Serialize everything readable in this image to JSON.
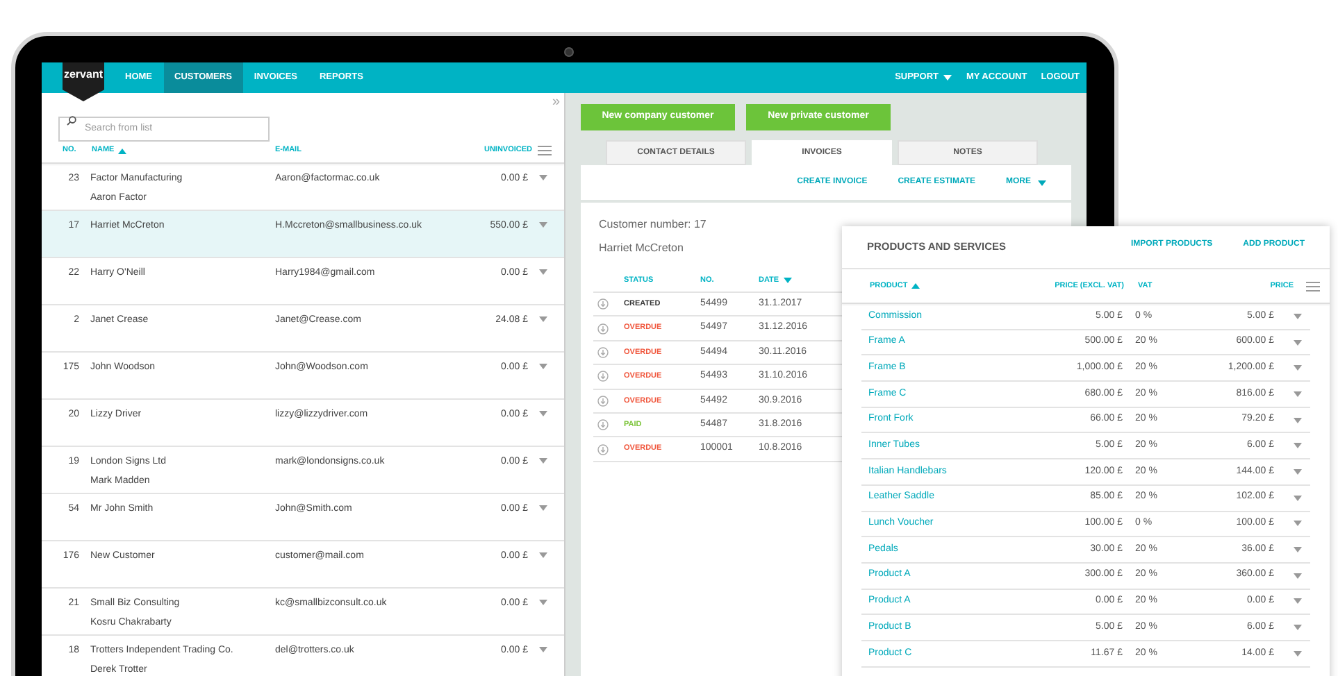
{
  "nav": {
    "logo": "zervant",
    "items": [
      {
        "label": "HOME",
        "selected": false
      },
      {
        "label": "CUSTOMERS",
        "selected": true
      },
      {
        "label": "INVOICES",
        "selected": false
      },
      {
        "label": "REPORTS",
        "selected": false
      }
    ],
    "right_items": [
      {
        "label": "SUPPORT",
        "has_menu": true
      },
      {
        "label": "MY ACCOUNT",
        "has_menu": false
      },
      {
        "label": "LOGOUT",
        "has_menu": false
      }
    ]
  },
  "customer_list": {
    "search": {
      "placeholder": "Search from list"
    },
    "collapse": "»",
    "columns": [
      {
        "label": "NO.",
        "sorted": false
      },
      {
        "label": "NAME",
        "sorted": true,
        "descending": false
      },
      {
        "label": "E-MAIL",
        "sorted": false
      },
      {
        "label": "UNINVOICED",
        "sorted": false
      }
    ],
    "rows": [
      {
        "no": "23",
        "name": "Factor Manufacturing",
        "contact": "Aaron Factor",
        "email": "Aaron@factormac.co.uk",
        "uninvoiced": "0.00 £",
        "selected": false
      },
      {
        "no": "17",
        "name": "Harriet McCreton",
        "email": "H.Mccreton@smallbusiness.co.uk",
        "uninvoiced": "550.00 £",
        "selected": true
      },
      {
        "no": "22",
        "name": "Harry O'Neill",
        "email": "Harry1984@gmail.com",
        "uninvoiced": "0.00 £",
        "selected": false
      },
      {
        "no": "2",
        "name": "Janet Crease",
        "email": "Janet@Crease.com",
        "uninvoiced": "24.08 £",
        "selected": false
      },
      {
        "no": "175",
        "name": "John Woodson",
        "email": "John@Woodson.com",
        "uninvoiced": "0.00 £",
        "selected": false
      },
      {
        "no": "20",
        "name": "Lizzy Driver",
        "email": "lizzy@lizzydriver.com",
        "uninvoiced": "0.00 £",
        "selected": false
      },
      {
        "no": "19",
        "name": "London Signs Ltd",
        "contact": "Mark Madden",
        "email": "mark@londonsigns.co.uk",
        "uninvoiced": "0.00 £",
        "selected": false
      },
      {
        "no": "54",
        "name": "Mr John Smith",
        "email": "John@Smith.com",
        "uninvoiced": "0.00 £",
        "selected": false
      },
      {
        "no": "176",
        "name": "New Customer",
        "email": "customer@mail.com",
        "uninvoiced": "0.00 £",
        "selected": false
      },
      {
        "no": "21",
        "name": "Small Biz Consulting",
        "contact": "Kosru Chakrabarty",
        "email": "kc@smallbizconsult.co.uk",
        "uninvoiced": "0.00 £",
        "selected": false
      },
      {
        "no": "18",
        "name": "Trotters Independent Trading Co.",
        "contact": "Derek Trotter",
        "email": "del@trotters.co.uk",
        "uninvoiced": "0.00 £",
        "selected": false
      }
    ]
  },
  "customer_detail": {
    "buttons": [
      "New company customer",
      "New private customer"
    ],
    "tabs": [
      {
        "label": "CONTACT DETAILS",
        "selected": false
      },
      {
        "label": "INVOICES",
        "selected": true
      },
      {
        "label": "NOTES",
        "selected": false
      }
    ],
    "actions": [
      {
        "label": "CREATE INVOICE",
        "has_menu": false
      },
      {
        "label": "CREATE ESTIMATE",
        "has_menu": false
      },
      {
        "label": "MORE",
        "has_menu": true
      }
    ],
    "customer_number": "Customer number: 17",
    "customer_name": "Harriet McCreton",
    "columns": [
      {
        "label": "STATUS",
        "sorted": false
      },
      {
        "label": "NO.",
        "sorted": false
      },
      {
        "label": "DATE",
        "sorted": true,
        "descending": true
      }
    ],
    "invoices": [
      {
        "status": "CREATED",
        "color": "#333333",
        "no": "54499",
        "date": "31.1.2017"
      },
      {
        "status": "OVERDUE",
        "color": "#f0563c",
        "no": "54497",
        "date": "31.12.2016"
      },
      {
        "status": "OVERDUE",
        "color": "#f0563c",
        "no": "54494",
        "date": "30.11.2016"
      },
      {
        "status": "OVERDUE",
        "color": "#f0563c",
        "no": "54493",
        "date": "31.10.2016"
      },
      {
        "status": "OVERDUE",
        "color": "#f0563c",
        "no": "54492",
        "date": "30.9.2016"
      },
      {
        "status": "PAID",
        "color": "#7cc43a",
        "no": "54487",
        "date": "31.8.2016"
      },
      {
        "status": "OVERDUE",
        "color": "#f0563c",
        "no": "100001",
        "date": "10.8.2016"
      }
    ]
  },
  "products": {
    "title": "PRODUCTS AND SERVICES",
    "actions": [
      "IMPORT PRODUCTS",
      "ADD PRODUCT"
    ],
    "columns": [
      {
        "label": "PRODUCT",
        "sorted": true,
        "descending": false
      },
      {
        "label": "PRICE (EXCL. VAT)",
        "sorted": false
      },
      {
        "label": "VAT",
        "sorted": false
      },
      {
        "label": "PRICE",
        "sorted": false
      }
    ],
    "rows": [
      {
        "name": "Commission",
        "price_excl": "5.00 £",
        "vat": "0 %",
        "price": "5.00 £"
      },
      {
        "name": "Frame A",
        "price_excl": "500.00 £",
        "vat": "20 %",
        "price": "600.00 £"
      },
      {
        "name": "Frame B",
        "price_excl": "1,000.00 £",
        "vat": "20 %",
        "price": "1,200.00 £"
      },
      {
        "name": "Frame C",
        "price_excl": "680.00 £",
        "vat": "20 %",
        "price": "816.00 £"
      },
      {
        "name": "Front Fork",
        "price_excl": "66.00 £",
        "vat": "20 %",
        "price": "79.20 £"
      },
      {
        "name": "Inner Tubes",
        "price_excl": "5.00 £",
        "vat": "20 %",
        "price": "6.00 £"
      },
      {
        "name": "Italian Handlebars",
        "price_excl": "120.00 £",
        "vat": "20 %",
        "price": "144.00 £"
      },
      {
        "name": "Leather Saddle",
        "price_excl": "85.00 £",
        "vat": "20 %",
        "price": "102.00 £"
      },
      {
        "name": "Lunch Voucher",
        "price_excl": "100.00 £",
        "vat": "0 %",
        "price": "100.00 £"
      },
      {
        "name": "Pedals",
        "price_excl": "30.00 £",
        "vat": "20 %",
        "price": "36.00 £"
      },
      {
        "name": "Product A",
        "price_excl": "300.00 £",
        "vat": "20 %",
        "price": "360.00 £"
      },
      {
        "name": "Product A",
        "price_excl": "0.00 £",
        "vat": "20 %",
        "price": "0.00 £"
      },
      {
        "name": "Product B",
        "price_excl": "5.00 £",
        "vat": "20 %",
        "price": "6.00 £"
      },
      {
        "name": "Product C",
        "price_excl": "11.67 £",
        "vat": "20 %",
        "price": "14.00 £"
      }
    ]
  }
}
